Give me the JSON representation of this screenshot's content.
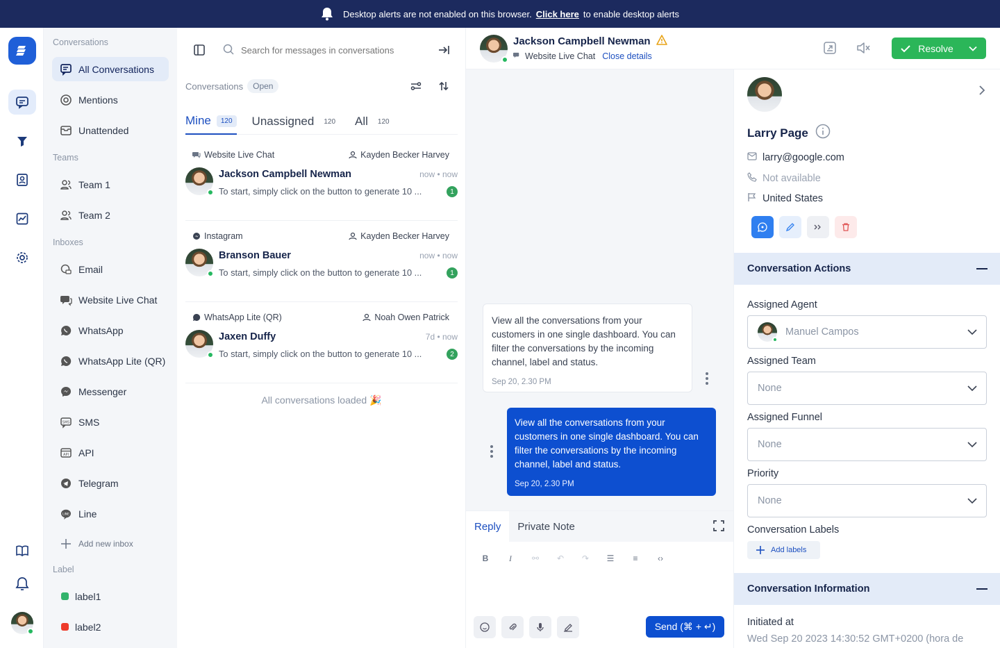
{
  "banner": {
    "text": "Desktop alerts are not enabled on this browser.",
    "link": "Click here",
    "suffix": "to enable desktop alerts"
  },
  "sidebar": {
    "conversations_heading": "Conversations",
    "items": [
      {
        "label": "All Conversations",
        "icon": "chat-icon"
      },
      {
        "label": "Mentions",
        "icon": "at-icon"
      },
      {
        "label": "Unattended",
        "icon": "inbox-icon"
      }
    ],
    "teams_heading": "Teams",
    "teams": [
      "Team 1",
      "Team 2"
    ],
    "inboxes_heading": "Inboxes",
    "inboxes": [
      "Email",
      "Website Live Chat",
      "WhatsApp",
      "WhatsApp Lite (QR)",
      "Messenger",
      "SMS",
      "API",
      "Telegram",
      "Line"
    ],
    "add_inbox": "Add new inbox",
    "label_heading": "Label",
    "labels": [
      {
        "name": "label1",
        "color": "#33b36c"
      },
      {
        "name": "label2",
        "color": "#ee3b2b"
      }
    ]
  },
  "list": {
    "search_placeholder": "Search for messages in conversations",
    "filter_label": "Conversations",
    "status": "Open",
    "tabs": [
      {
        "label": "Mine",
        "count": "120"
      },
      {
        "label": "Unassigned",
        "count": "120"
      },
      {
        "label": "All",
        "count": "120"
      }
    ],
    "conversations": [
      {
        "inbox": "Website Live Chat",
        "agent": "Kayden Becker Harvey",
        "name": "Jackson Campbell Newman",
        "time": "now • now",
        "preview": "To start, simply click on the button to generate 10 ...",
        "unread": "1"
      },
      {
        "inbox": "Instagram",
        "agent": "Kayden Becker Harvey",
        "name": "Branson Bauer",
        "time": "now • now",
        "preview": "To start, simply click on the button to generate 10 ...",
        "unread": "1"
      },
      {
        "inbox": "WhatsApp Lite (QR)",
        "agent": "Noah Owen Patrick",
        "name": "Jaxen Duffy",
        "time": "7d • now",
        "preview": "To start, simply click on the button to generate 10 ...",
        "unread": "2"
      }
    ],
    "loaded_text": "All conversations loaded 🎉"
  },
  "chat": {
    "contact_name": "Jackson Campbell Newman",
    "inbox": "Website Live Chat",
    "close_details": "Close details",
    "resolve": "Resolve",
    "messages": [
      {
        "text": "View all the conversations from your customers in one single dashboard. You can filter the conversations by the incoming channel, label and status.",
        "time": "Sep 20, 2.30 PM"
      },
      {
        "text": "View all the conversations from your customers in one single dashboard. You can filter the conversations by the incoming channel, label and status.",
        "time": "Sep 20, 2.30 PM"
      }
    ],
    "reply_tab": "Reply",
    "private_tab": "Private Note",
    "send": "Send (⌘ + ↵)"
  },
  "details": {
    "name": "Larry Page",
    "email": "larry@google.com",
    "phone": "Not available",
    "country": "United States",
    "actions_title": "Conversation Actions",
    "assigned_agent_label": "Assigned Agent",
    "assigned_agent": "Manuel Campos",
    "assigned_team_label": "Assigned Team",
    "assigned_team": "None",
    "assigned_funnel_label": "Assigned Funnel",
    "assigned_funnel": "None",
    "priority_label": "Priority",
    "priority": "None",
    "labels_label": "Conversation Labels",
    "add_labels": "Add labels",
    "info_title": "Conversation Information",
    "initiated_label": "Initiated at",
    "initiated_value": "Wed Sep 20 2023 14:30:52 GMT+0200 (hora de"
  },
  "colors": {
    "banner": "#1c2a5e",
    "accent": "#0d4fd0",
    "resolve": "#2bb659",
    "online": "#26b860"
  }
}
